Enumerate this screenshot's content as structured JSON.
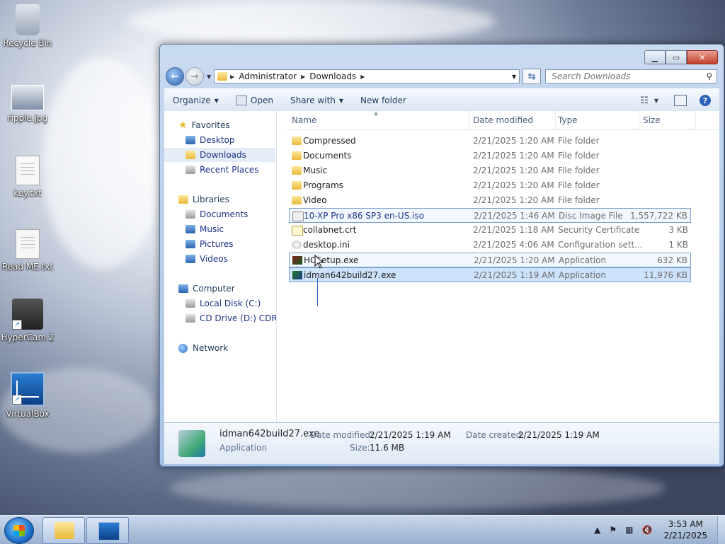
{
  "desktop": {
    "icons": [
      {
        "label": "Recycle Bin",
        "icon": "recycle-bin-icon"
      },
      {
        "label": "ripple.jpg",
        "icon": "image-file-icon"
      },
      {
        "label": "key.txt",
        "icon": "text-file-icon"
      },
      {
        "label": "Read ME.txt",
        "icon": "text-file-icon"
      },
      {
        "label": "HyperCam 2",
        "icon": "hypercam-icon"
      },
      {
        "label": "VirtualBox",
        "icon": "virtualbox-icon"
      }
    ]
  },
  "explorer": {
    "address": [
      "Administrator",
      "Downloads"
    ],
    "search_placeholder": "Search Downloads",
    "toolbar": {
      "organize": "Organize",
      "open": "Open",
      "share_with": "Share with",
      "new_folder": "New folder"
    },
    "nav": {
      "favorites": "Favorites",
      "desktop": "Desktop",
      "downloads": "Downloads",
      "recent_places": "Recent Places",
      "libraries": "Libraries",
      "documents": "Documents",
      "music": "Music",
      "pictures": "Pictures",
      "videos": "Videos",
      "computer": "Computer",
      "local_disk": "Local Disk (C:)",
      "cd_drive": "CD Drive (D:) CDROM",
      "network": "Network"
    },
    "columns": {
      "name": "Name",
      "date": "Date modified",
      "type": "Type",
      "size": "Size"
    },
    "files": [
      {
        "name": "Compressed",
        "date": "2/21/2025 1:20 AM",
        "type": "File folder",
        "size": "",
        "icon": "folder-icon"
      },
      {
        "name": "Documents",
        "date": "2/21/2025 1:20 AM",
        "type": "File folder",
        "size": "",
        "icon": "folder-icon"
      },
      {
        "name": "Music",
        "date": "2/21/2025 1:20 AM",
        "type": "File folder",
        "size": "",
        "icon": "folder-icon"
      },
      {
        "name": "Programs",
        "date": "2/21/2025 1:20 AM",
        "type": "File folder",
        "size": "",
        "icon": "folder-icon"
      },
      {
        "name": "Video",
        "date": "2/21/2025 1:20 AM",
        "type": "File folder",
        "size": "",
        "icon": "folder-icon"
      },
      {
        "name": "10-XP Pro x86 SP3 en-US.iso",
        "date": "2/21/2025 1:46 AM",
        "type": "Disc Image File",
        "size": "1,557,722 KB",
        "icon": "disc-image-icon"
      },
      {
        "name": "collabnet.crt",
        "date": "2/21/2025 1:18 AM",
        "type": "Security Certificate",
        "size": "3 KB",
        "icon": "certificate-icon"
      },
      {
        "name": "desktop.ini",
        "date": "2/21/2025 4:06 AM",
        "type": "Configuration sett...",
        "size": "1 KB",
        "icon": "config-file-icon"
      },
      {
        "name": "HCSetup.exe",
        "date": "2/21/2025 1:20 AM",
        "type": "Application",
        "size": "632 KB",
        "icon": "installer-icon"
      },
      {
        "name": "idman642build27.exe",
        "date": "2/21/2025 1:19 AM",
        "type": "Application",
        "size": "11,976 KB",
        "icon": "installer-icon"
      }
    ],
    "details": {
      "name": "idman642build27.exe",
      "kind": "Application",
      "date_modified_label": "Date modified:",
      "date_modified": "2/21/2025 1:19 AM",
      "date_created_label": "Date created:",
      "date_created": "2/21/2025 1:19 AM",
      "size_label": "Size:",
      "size": "11.6 MB"
    }
  },
  "taskbar": {
    "time": "3:53 AM",
    "date": "2/21/2025"
  }
}
